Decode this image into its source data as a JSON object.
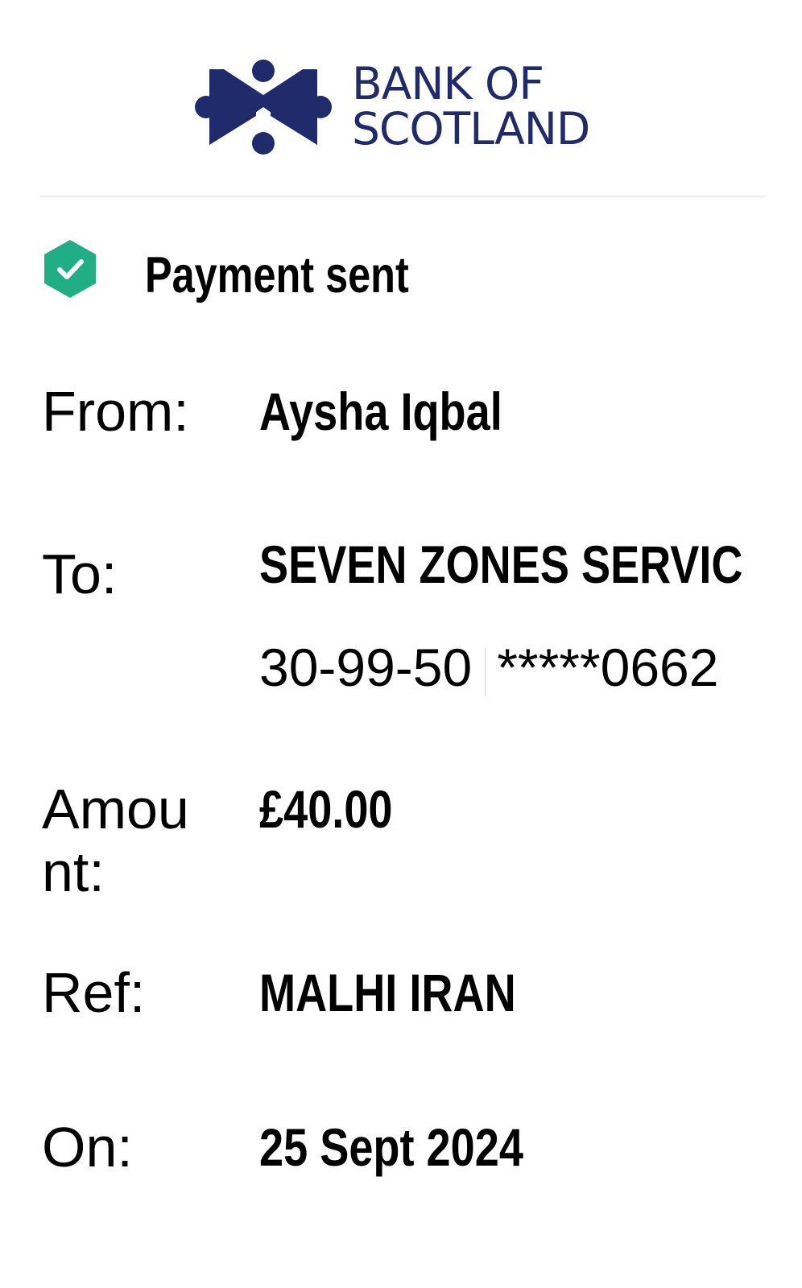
{
  "brand": {
    "name_line1": "BANK OF",
    "name_line2": "SCOTLAND",
    "brand_color": "#1f2b6b"
  },
  "status": {
    "text": "Payment sent",
    "icon": "check-shield-icon",
    "icon_color": "#1fae86"
  },
  "details": {
    "from_label": "From:",
    "from_value": "Aysha Iqbal",
    "to_label": "To:",
    "to_value": "SEVEN ZONES SERVIC",
    "sort_code": "30-99-50",
    "account_number": "*****0662",
    "amount_label": "Amount:",
    "amount_value": "£40.00",
    "ref_label": "Ref:",
    "ref_value": "MALHI IRAN",
    "on_label": "On:",
    "on_value": "25 Sept 2024"
  }
}
